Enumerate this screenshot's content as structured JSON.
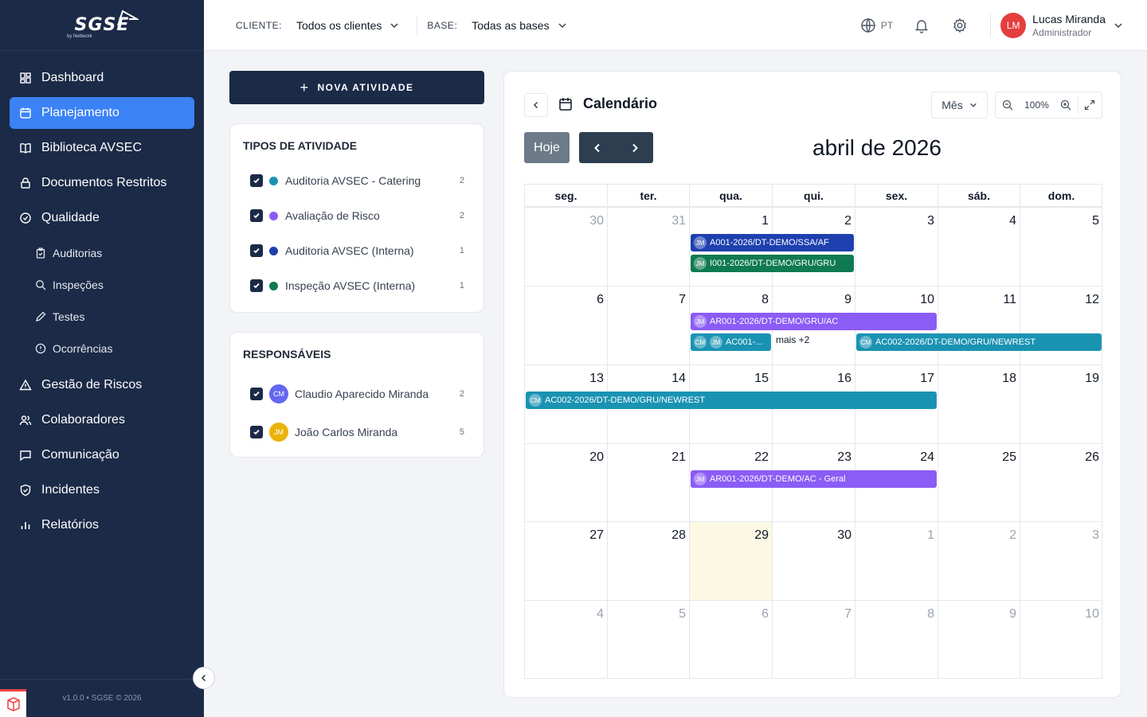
{
  "brand": {
    "logo": "SGSE",
    "sub": "by Nettwork"
  },
  "sidebar": {
    "items": [
      {
        "label": "Dashboard",
        "icon": "grid-icon"
      },
      {
        "label": "Planejamento",
        "icon": "calendar-icon"
      },
      {
        "label": "Biblioteca AVSEC",
        "icon": "book-icon"
      },
      {
        "label": "Documentos Restritos",
        "icon": "lock-icon"
      },
      {
        "label": "Qualidade",
        "icon": "check-circle-icon"
      }
    ],
    "subitems": [
      {
        "label": "Auditorias",
        "icon": "clipboard-icon"
      },
      {
        "label": "Inspeções",
        "icon": "search-icon"
      },
      {
        "label": "Testes",
        "icon": "pencil-icon"
      },
      {
        "label": "Ocorrências",
        "icon": "alert-circle-icon"
      }
    ],
    "items2": [
      {
        "label": "Gestão de Riscos",
        "icon": "warning-icon"
      },
      {
        "label": "Colaboradores",
        "icon": "users-icon"
      },
      {
        "label": "Comunicação",
        "icon": "message-icon"
      },
      {
        "label": "Incidentes",
        "icon": "shield-icon"
      },
      {
        "label": "Relatórios",
        "icon": "bar-chart-icon"
      }
    ],
    "footer": "v1.0.0 • SGSE © 2026"
  },
  "topbar": {
    "client_label": "CLIENTE:",
    "client_value": "Todos os clientes",
    "base_label": "BASE:",
    "base_value": "Todas as bases",
    "lang": "PT",
    "user_initials": "LM",
    "user_name": "Lucas Miranda",
    "user_role": "Administrador"
  },
  "left": {
    "new_button": "NOVA ATIVIDADE",
    "types_title": "TIPOS DE ATIVIDADE",
    "types": [
      {
        "label": "Auditoria AVSEC - Catering",
        "count": "2",
        "color": "#1a93b3"
      },
      {
        "label": "Avaliação de Risco",
        "count": "2",
        "color": "#8b5cf6"
      },
      {
        "label": "Auditoria AVSEC (Interna)",
        "count": "1",
        "color": "#1e40af"
      },
      {
        "label": "Inspeção AVSEC (Interna)",
        "count": "1",
        "color": "#0f7a52"
      }
    ],
    "resp_title": "RESPONSÁVEIS",
    "responsibles": [
      {
        "initials": "CM",
        "name": "Claudio Aparecido Miranda",
        "count": "2",
        "color": "#6366f1"
      },
      {
        "initials": "JM",
        "name": "João Carlos Miranda",
        "count": "5",
        "color": "#eab308"
      }
    ]
  },
  "calendar": {
    "title": "Calendário",
    "view": "Mês",
    "zoom": "100%",
    "today_label": "Hoje",
    "month_title": "abril de 2026",
    "weekdays": [
      "seg.",
      "ter.",
      "qua.",
      "qui.",
      "sex.",
      "sáb.",
      "dom."
    ],
    "weeks": [
      [
        "30",
        "31",
        "1",
        "2",
        "3",
        "4",
        "5"
      ],
      [
        "6",
        "7",
        "8",
        "9",
        "10",
        "11",
        "12"
      ],
      [
        "13",
        "14",
        "15",
        "16",
        "17",
        "18",
        "19"
      ],
      [
        "20",
        "21",
        "22",
        "23",
        "24",
        "25",
        "26"
      ],
      [
        "27",
        "28",
        "29",
        "30",
        "1",
        "2",
        "3"
      ],
      [
        "4",
        "5",
        "6",
        "7",
        "8",
        "9",
        "10"
      ]
    ],
    "events": [
      {
        "label": "A001-2026/DT-DEMO/SSA/AF",
        "avatars": [
          "JM"
        ],
        "color": "#1e40af",
        "week": 0,
        "start": 2,
        "span": 2,
        "row": 0
      },
      {
        "label": "I001-2026/DT-DEMO/GRU/GRU",
        "avatars": [
          "JM"
        ],
        "color": "#0f7a52",
        "week": 0,
        "start": 2,
        "span": 2,
        "row": 1
      },
      {
        "label": "AR001-2026/DT-DEMO/GRU/AC",
        "avatars": [
          "JM"
        ],
        "color": "#8b5cf6",
        "week": 1,
        "start": 2,
        "span": 3,
        "row": 0
      },
      {
        "label": "AC001-...",
        "avatars": [
          "CM",
          "JM"
        ],
        "color": "#1a93b3",
        "week": 1,
        "start": 2,
        "span": 1,
        "row": 1
      },
      {
        "label": "AC002-2026/DT-DEMO/GRU/NEWREST",
        "avatars": [
          "CM"
        ],
        "color": "#1a93b3",
        "week": 1,
        "start": 4,
        "span": 3,
        "row": 1
      },
      {
        "label": "AC002-2026/DT-DEMO/GRU/NEWREST",
        "avatars": [
          "CM"
        ],
        "color": "#1a93b3",
        "week": 2,
        "start": 0,
        "span": 5,
        "row": 0
      },
      {
        "label": "AR001-2026/DT-DEMO/AC - Geral",
        "avatars": [
          "JM"
        ],
        "color": "#8b5cf6",
        "week": 3,
        "start": 2,
        "span": 3,
        "row": 0
      }
    ],
    "more_link": "mais +2"
  }
}
